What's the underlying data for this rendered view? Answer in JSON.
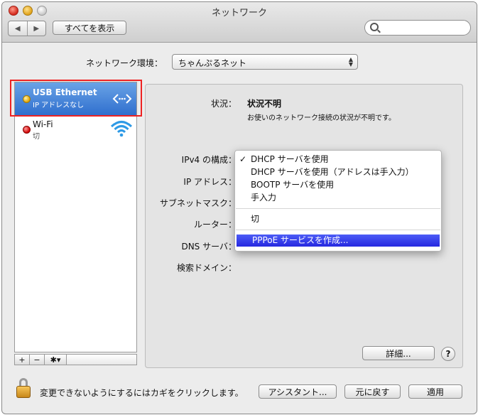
{
  "window": {
    "title": "ネットワーク"
  },
  "toolbar": {
    "back_label": "◀",
    "forward_label": "▶",
    "show_all_label": "すべてを表示",
    "search_placeholder": ""
  },
  "location": {
    "label": "ネットワーク環境：",
    "value": "ちゃんぷるネット"
  },
  "services": [
    {
      "name": "USB Ethernet",
      "status": "IP アドレスなし",
      "status_color": "#e0a300",
      "icon": "ethernet-arrows-icon",
      "selected": true
    },
    {
      "name": "Wi-Fi",
      "status": "切",
      "status_color": "#d10000",
      "icon": "wifi-icon",
      "selected": false
    }
  ],
  "sidebar_toolbar": {
    "add": "+",
    "remove": "−",
    "action": "✱▾"
  },
  "detail": {
    "status_label": "状況：",
    "status_value": "状況不明",
    "status_desc": "お使いのネットワーク接続の状況が不明です。",
    "fields": [
      {
        "label": "IPv4 の構成：",
        "value": ""
      },
      {
        "label": "IP アドレス：",
        "value": ""
      },
      {
        "label": "サブネットマスク：",
        "value": ""
      },
      {
        "label": "ルーター：",
        "value": ""
      },
      {
        "label": "DNS サーバ：",
        "value": ""
      },
      {
        "label": "検索ドメイン：",
        "value": ""
      }
    ],
    "advanced_label": "詳細...",
    "help_label": "?"
  },
  "ipv4_menu": {
    "check_mark": "✓",
    "items": [
      "DHCP サーバを使用",
      "DHCP サーバを使用（アドレスは手入力）",
      "BOOTP サーバを使用",
      "手入力",
      "切",
      "PPPoE サービスを作成..."
    ],
    "checked_index": 0,
    "highlighted_index": 5
  },
  "footer": {
    "lock_text": "変更できないようにするにはカギをクリックします。",
    "assistant_label": "アシスタント...",
    "revert_label": "元に戻す",
    "apply_label": "適用"
  }
}
